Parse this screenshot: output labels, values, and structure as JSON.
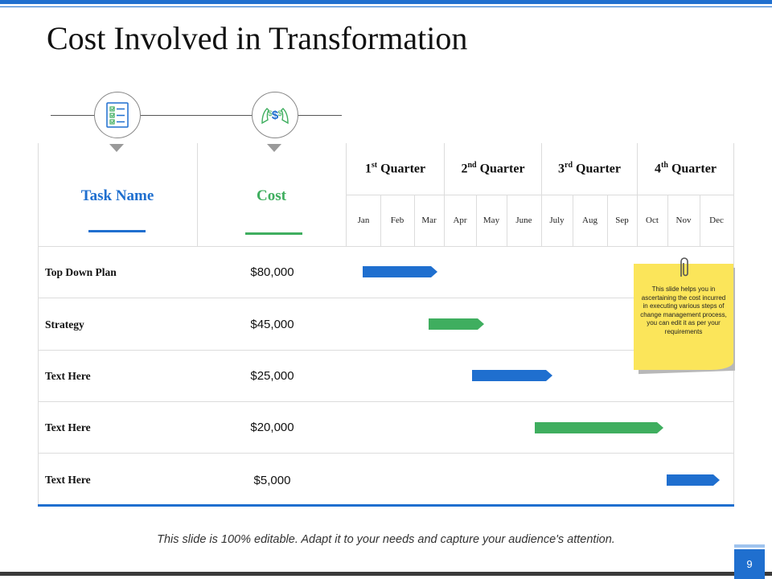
{
  "slide": {
    "title": "Cost Involved in Transformation",
    "footer": "This slide is 100% editable. Adapt it to your needs and capture your audience's attention.",
    "page_number": "9"
  },
  "icons": {
    "task_icon": "checklist-icon",
    "cost_icon": "hands-dollar-icon"
  },
  "table": {
    "task_header": "Task Name",
    "cost_header": "Cost",
    "quarters": [
      {
        "num": "1",
        "suffix": "st",
        "label": "Quarter"
      },
      {
        "num": "2",
        "suffix": "nd",
        "label": "Quarter"
      },
      {
        "num": "3",
        "suffix": "rd",
        "label": "Quarter"
      },
      {
        "num": "4",
        "suffix": "th",
        "label": "Quarter"
      }
    ],
    "months": [
      "Jan",
      "Feb",
      "Mar",
      "Apr",
      "May",
      "June",
      "July",
      "Aug",
      "Sep",
      "Oct",
      "Nov",
      "Dec"
    ],
    "rows": [
      {
        "task": "Top Down Plan",
        "cost": "$80,000"
      },
      {
        "task": "Strategy",
        "cost": "$45,000"
      },
      {
        "task": "Text Here",
        "cost": "$25,000"
      },
      {
        "task": "Text Here",
        "cost": "$20,000"
      },
      {
        "task": "Text Here",
        "cost": "$5,000"
      }
    ]
  },
  "note": {
    "text": "This slide helps you in ascertaining the cost incurred in executing various steps of change management process, you can edit it as per your requirements"
  },
  "colors": {
    "accent_blue": "#1f6fcf",
    "accent_green": "#3fae5f",
    "note_yellow": "#fbe55a"
  }
}
